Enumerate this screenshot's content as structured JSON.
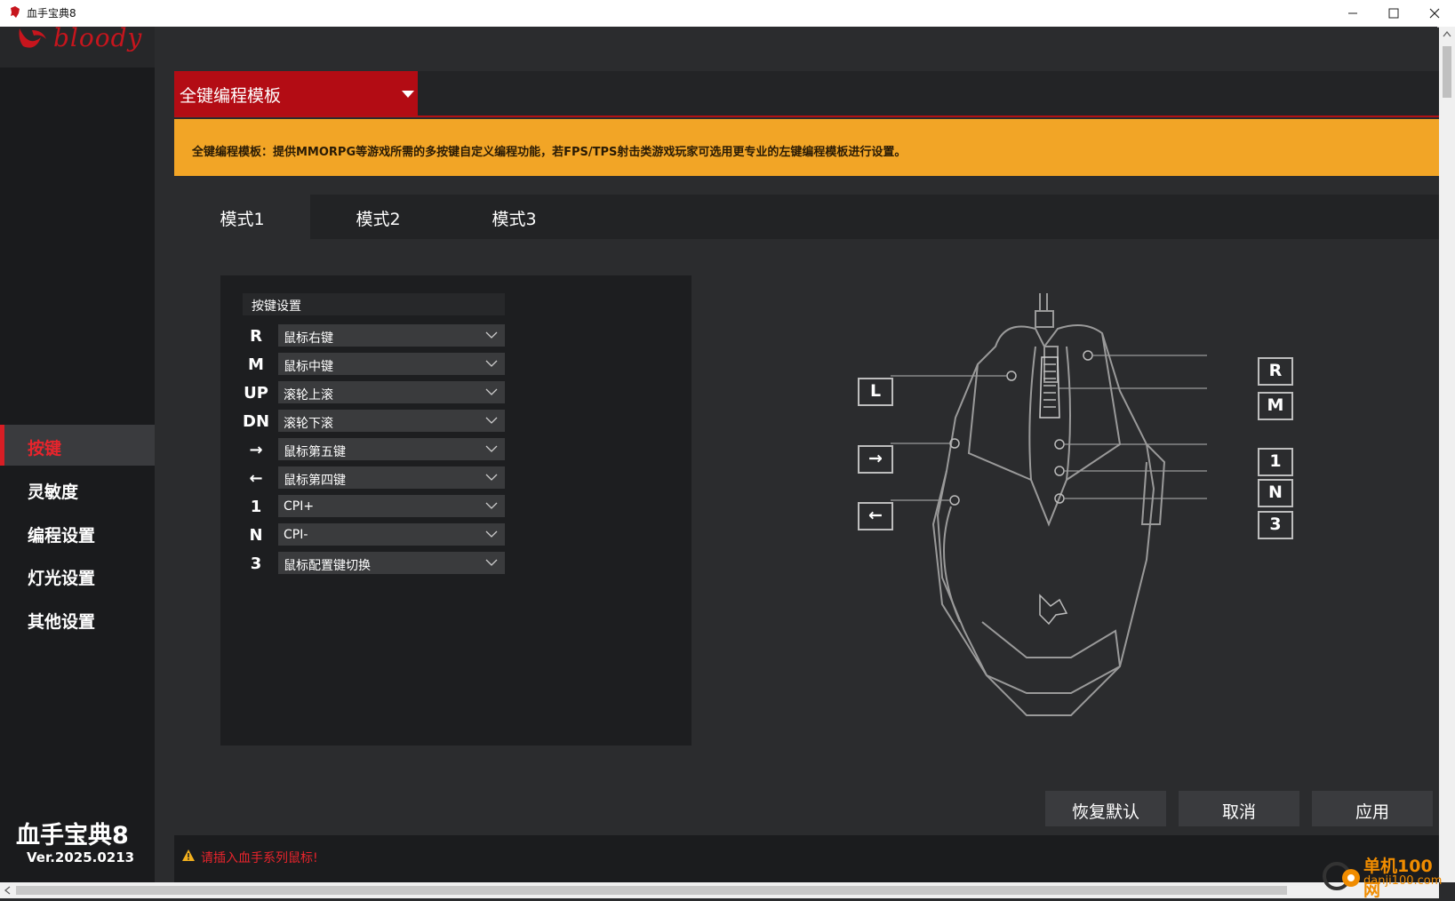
{
  "window": {
    "title": "血手宝典8",
    "controls": [
      "minimize-icon",
      "maximize-icon",
      "close-icon"
    ]
  },
  "sidebar": {
    "brand": "bloody",
    "items": [
      {
        "label": "按键",
        "active": true
      },
      {
        "label": "灵敏度",
        "active": false
      },
      {
        "label": "编程设置",
        "active": false
      },
      {
        "label": "灯光设置",
        "active": false
      },
      {
        "label": "其他设置",
        "active": false
      }
    ],
    "app_name": "血手宝典8",
    "version": "Ver.2025.0213"
  },
  "template": {
    "selected": "全键编程模板"
  },
  "notice": "全键编程模板：提供MMORPG等游戏所需的多按键自定义编程功能，若FPS/TPS射击类游戏玩家可选用更专业的左键编程模板进行设置。",
  "tabs": [
    {
      "label": "模式1",
      "active": true
    },
    {
      "label": "模式2",
      "active": false
    },
    {
      "label": "模式3",
      "active": false
    }
  ],
  "key_settings": {
    "header": "按键设置",
    "rows": [
      {
        "key": "R",
        "value": "鼠标右键"
      },
      {
        "key": "M",
        "value": "鼠标中键"
      },
      {
        "key": "UP",
        "value": "滚轮上滚"
      },
      {
        "key": "DN",
        "value": "滚轮下滚"
      },
      {
        "key": "→",
        "value": "鼠标第五键"
      },
      {
        "key": "←",
        "value": "鼠标第四键"
      },
      {
        "key": "1",
        "value": "CPI+"
      },
      {
        "key": "N",
        "value": "CPI-"
      },
      {
        "key": "3",
        "value": "鼠标配置键切换"
      }
    ]
  },
  "mouse_diagram": {
    "left_labels": [
      "L",
      "→",
      "←"
    ],
    "right_labels": [
      "R",
      "M",
      "1",
      "N",
      "3"
    ]
  },
  "actions": {
    "restore": "恢复默认",
    "cancel": "取消",
    "apply": "应用"
  },
  "status": {
    "warning": "请插入血手系列鼠标!"
  },
  "watermark": {
    "line1": "单机100网",
    "line2": "danji100.com"
  },
  "colors": {
    "accent_red": "#b30c14",
    "notice_orange": "#f2a526",
    "sidebar_bg": "#1a1b1d",
    "main_bg": "#2b2c2e",
    "warning_red": "#e8242c"
  }
}
